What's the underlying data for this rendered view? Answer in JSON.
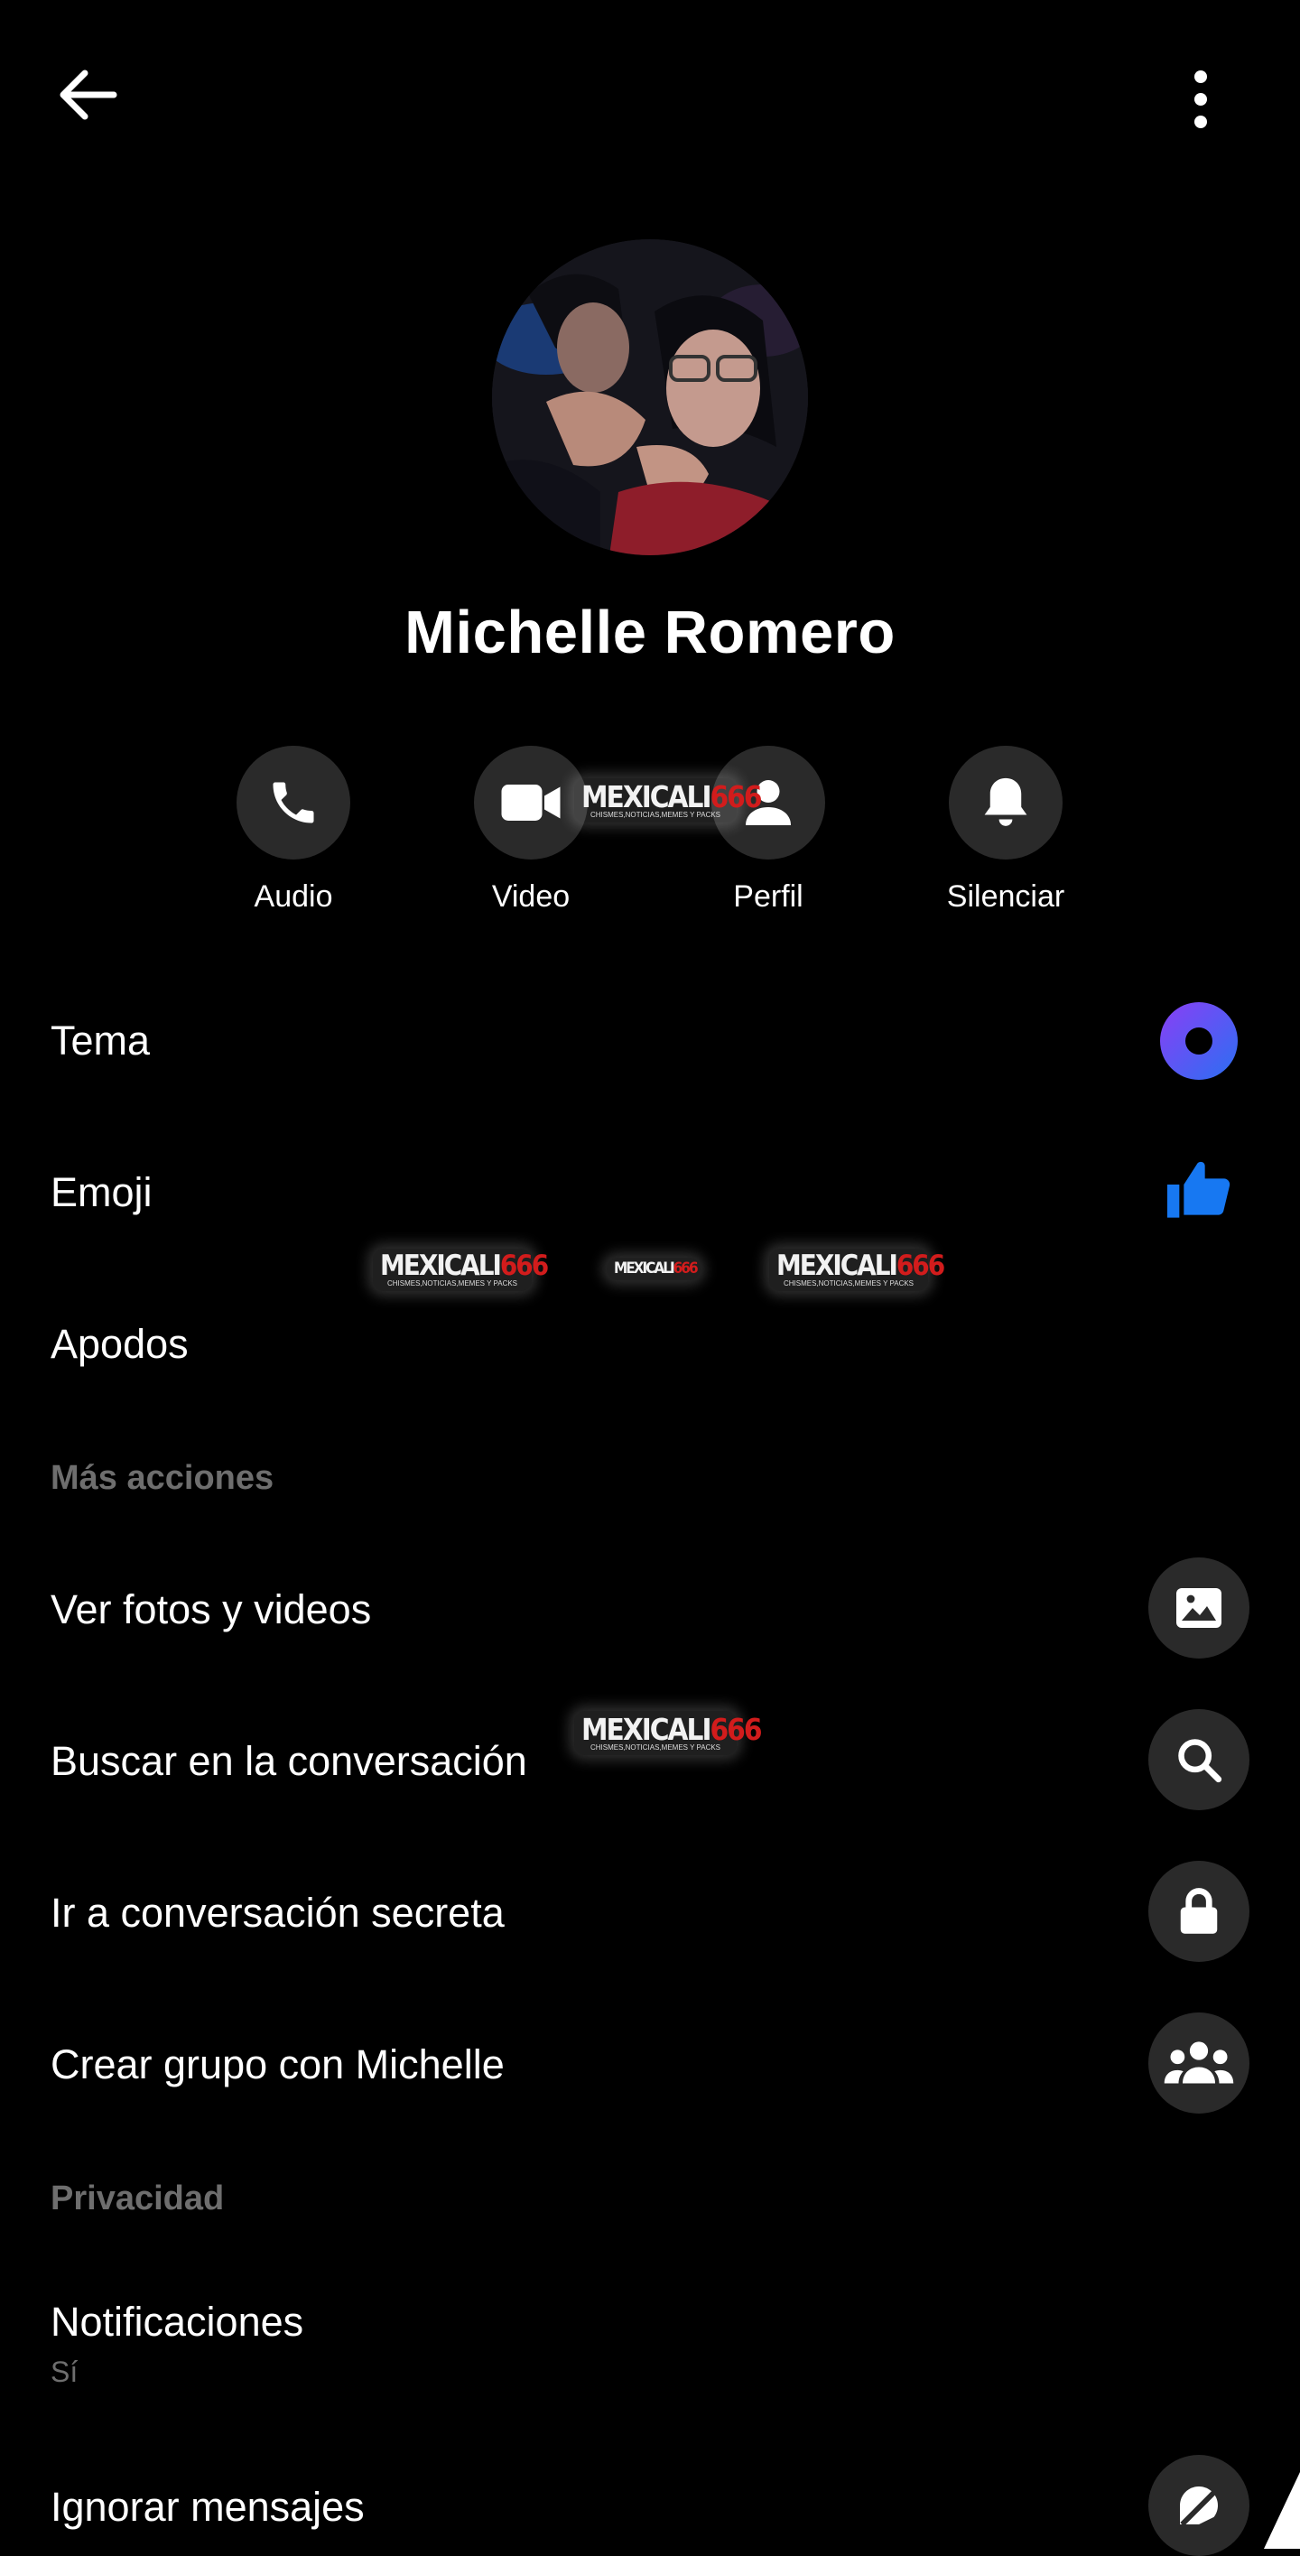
{
  "contact": {
    "name": "Michelle Romero"
  },
  "quick_actions": [
    {
      "label": "Audio",
      "icon": "phone-icon"
    },
    {
      "label": "Video",
      "icon": "video-camera-icon"
    },
    {
      "label": "Perfil",
      "icon": "person-icon"
    },
    {
      "label": "Silenciar",
      "icon": "bell-icon"
    }
  ],
  "settings": {
    "tema": {
      "label": "Tema",
      "accent": "#7b3ff2",
      "accent2": "#2f6ff0"
    },
    "emoji": {
      "label": "Emoji",
      "color": "#1778f2"
    },
    "apodos": {
      "label": "Apodos"
    }
  },
  "more_actions": {
    "header": "Más acciones",
    "items": [
      {
        "label": "Ver fotos y videos",
        "icon": "image-icon"
      },
      {
        "label": "Buscar en la conversación",
        "icon": "search-icon"
      },
      {
        "label": "Ir a conversación secreta",
        "icon": "lock-icon"
      },
      {
        "label": "Crear grupo con Michelle",
        "icon": "group-icon"
      }
    ]
  },
  "privacy": {
    "header": "Privacidad",
    "notifications": {
      "label": "Notificaciones",
      "value": "Sí"
    },
    "ignore": {
      "label": "Ignorar mensajes",
      "icon": "ignore-icon"
    }
  },
  "watermark": {
    "part1": "MEXICALI",
    "part2": "666",
    "tagline": "CHISMES,NOTICIAS,MEMES Y PACKS"
  },
  "colors": {
    "background": "#000000",
    "circle": "#2a2a2a",
    "muted": "#6e6e6e"
  }
}
